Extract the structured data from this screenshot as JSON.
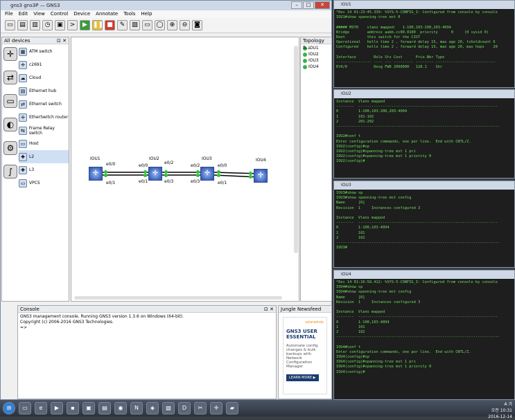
{
  "gns_window": {
    "title": "gns3 gns3P — GNS3",
    "menu": [
      "File",
      "Edit",
      "View",
      "Control",
      "Device",
      "Annotate",
      "Tools",
      "Help"
    ]
  },
  "devices_panel": {
    "title": "All devices",
    "items": [
      "ATM switch",
      "c2691",
      "Cloud",
      "Ethernet hub",
      "Ethernet switch",
      "EtherSwitch router",
      "Frame Relay switch",
      "Host",
      "L2",
      "L3",
      "VPCS"
    ],
    "selected": "L2"
  },
  "topology": {
    "nodes": [
      "IOU1",
      "IOU2",
      "IOU3",
      "IOU4"
    ],
    "ports": {
      "iou1_top": "e0/0",
      "iou1_bot": "e0/1",
      "iou2_tl": "e0/0",
      "iou2_bl": "e0/1",
      "iou2_tr": "e0/2",
      "iou2_br": "e0/3",
      "iou3_tl": "e0/2",
      "iou3_bl": "e0/3",
      "iou3_tr": "e0/0",
      "iou3_br": "e0/1"
    }
  },
  "topology_summary": {
    "title": "Topology S...",
    "items": [
      "IOU1",
      "IOU2",
      "IOU3",
      "IOU4"
    ]
  },
  "console": {
    "title": "Console",
    "lines": [
      "GNS3 management console. Running GNS3 version 1.3.6 on Windows (64-bit).",
      "Copyright (c) 2006-2016 GNS3 Technologies.",
      "",
      "=>"
    ]
  },
  "news": {
    "title": "Jungle Newsfeed",
    "brand": "solarwinds",
    "headline": "GNS3 USER ESSENTIAL",
    "body": "Automate config changes & bulk backups with Network Configuration Manager",
    "button": "LEARN MORE ▶"
  },
  "terminals": [
    {
      "title": "IOU1",
      "lines": [
        "*Dec 14 01:23:45.339: %SYS-5-CONFIG_I: Configured from console by console",
        "IOU1#show spanning-tree mst 0",
        "",
        "##### MST0    vlans mapped:   1-100,103-200,203-4094",
        "Bridge        address aabb.cc00.0100  priority      0     (0 sysid 0)",
        "Root          this switch for the CIST",
        "Operational   hello time 2 , forward delay 15, max age 20, txholdcount 6",
        "Configured    hello time 2 , forward delay 15, max age 20, max hops    20",
        "",
        "Interface        Role Sts Cost      Prio.Nbr Type",
        "---------------- ---- --- --------- -------- ---------------------------",
        "Et0/0            Desg FWD 2000000   128.1    Shr"
      ]
    },
    {
      "title": "IOU2",
      "lines": [
        "Instance  Vlans mapped",
        "--------  ---------------------------------------------------------------",
        "0         1-100,103-200,203-4094",
        "1         101-102",
        "2         201-202",
        "--------------------------------------------------------------------------",
        "",
        "IOU2#conf t",
        "Enter configuration commands, one per line.  End with CNTL/Z.",
        "IOU2(config)#sp",
        "IOU2(config)#spanning-tree mst 1 pri",
        "IOU2(config)#spanning-tree mst 1 priority 0",
        "IOU2(config)#"
      ]
    },
    {
      "title": "IOU3",
      "lines": [
        "IOU3#show sp",
        "IOU3#show spanning-tree mst config",
        "Name      [R]",
        "Revision  1     Instances configured 3",
        "",
        "Instance  Vlans mapped",
        "--------  ---------------------------------------------------------------",
        "0         1-100,103-4094",
        "1         101",
        "2         102",
        "--------------------------------------------------------------------------",
        "IOU3#"
      ]
    },
    {
      "title": "IOU4",
      "lines": [
        "*Dec 14 01:16:58.412: %SYS-5-CONFIG_I: Configured from console by console",
        "IOU4#show sp",
        "IOU4#show spanning-tree mst config",
        "Name      [R]",
        "Revision  1     Instances configured 3",
        "",
        "Instance  Vlans mapped",
        "--------  ---------------------------------------------------------------",
        "0         1-100,103-4094",
        "1         101",
        "2         102",
        "--------------------------------------------------------------------------",
        "",
        "IOU4#conf t",
        "Enter configuration commands, one per line.  End with CNTL/Z.",
        "IOU4(config)#sp",
        "IOU4(config)#spanning-tree mst 1 pri",
        "IOU4(config)#spanning-tree mst 1 priority 0",
        "IOU4(config)#"
      ]
    }
  ],
  "tray": {
    "lang": "A 가",
    "ampm": "오전 10:31",
    "date": "2016-12-14"
  }
}
